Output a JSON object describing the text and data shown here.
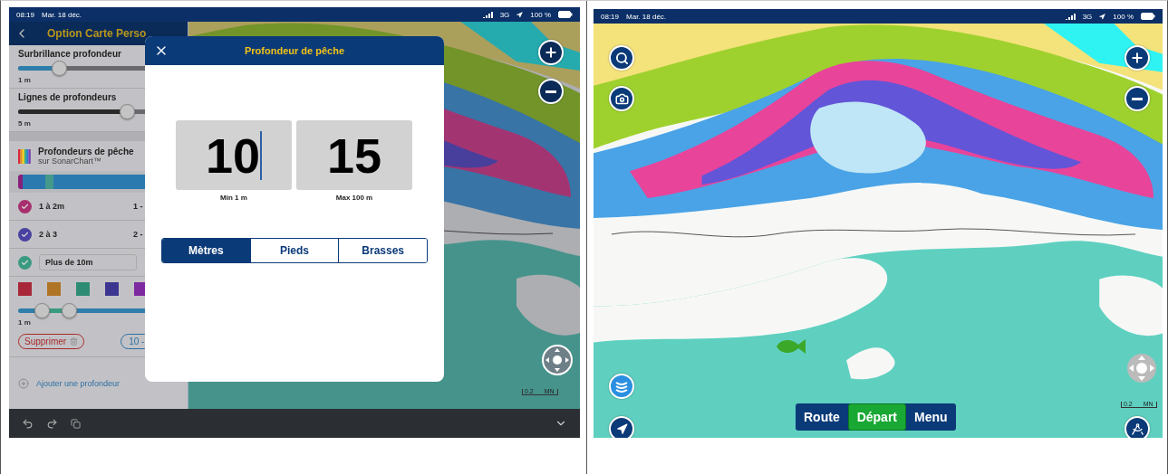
{
  "left_screen": {
    "status_bar": {
      "time": "08:19",
      "date": "Mar. 18 déc.",
      "network": "3G",
      "battery": "100 %"
    },
    "sidebar": {
      "title": "Option Carte Perso",
      "sliders": [
        {
          "label": "Surbrillance profondeur",
          "level": 0.3,
          "reading": "1 m"
        },
        {
          "label": "Lignes de profondeurs",
          "level": 0.8,
          "reading": "5 m"
        }
      ],
      "fishing": {
        "title": "Profondeurs de pêche",
        "subtitle": "sur SonarChart™",
        "ranges": [
          {
            "kind": "text",
            "label": "1 à 2m",
            "value": "1 -",
            "color": "#a8306e",
            "checked": true
          },
          {
            "kind": "text",
            "label": "2 à 3",
            "value": "2 -",
            "color": "#4a42a0",
            "checked": true
          },
          {
            "kind": "field",
            "label": "Plus de 10m",
            "color": "#3a9a82",
            "checked": true
          }
        ],
        "swatches": [
          {
            "color": "#a8283a"
          },
          {
            "color": "#b07426"
          },
          {
            "color": "#2f8c74"
          },
          {
            "color": "#3d3690"
          },
          {
            "color": "#7d2aa0"
          }
        ],
        "range_slider": {
          "thumbs": [
            {
              "level": 0.15
            },
            {
              "level": 0.33
            }
          ],
          "reading": "1 m"
        },
        "delete_button": "Supprimer",
        "value_pill": "10 -",
        "add_link": "Ajouter une profondeur"
      }
    },
    "modal": {
      "title": "Profondeur de pêche",
      "fields": [
        {
          "value": "10",
          "caption": "Min 1 m",
          "focused": true
        },
        {
          "value": "15",
          "caption": "Max 100 m",
          "focused": false
        }
      ],
      "units": [
        {
          "label": "Mètres",
          "selected": true
        },
        {
          "label": "Pieds",
          "selected": false
        },
        {
          "label": "Brasses",
          "selected": false
        }
      ]
    },
    "scale": "0.2 MN"
  },
  "right_screen": {
    "status_bar": {
      "time": "08:19",
      "date": "Mar. 18 déc.",
      "network": "3G",
      "battery": "100 %"
    },
    "nav_buttons": [
      {
        "label": "Route",
        "selected": false
      },
      {
        "label": "Départ",
        "selected": true
      },
      {
        "label": "Menu",
        "selected": false
      }
    ],
    "scale": "0.2 MN"
  }
}
